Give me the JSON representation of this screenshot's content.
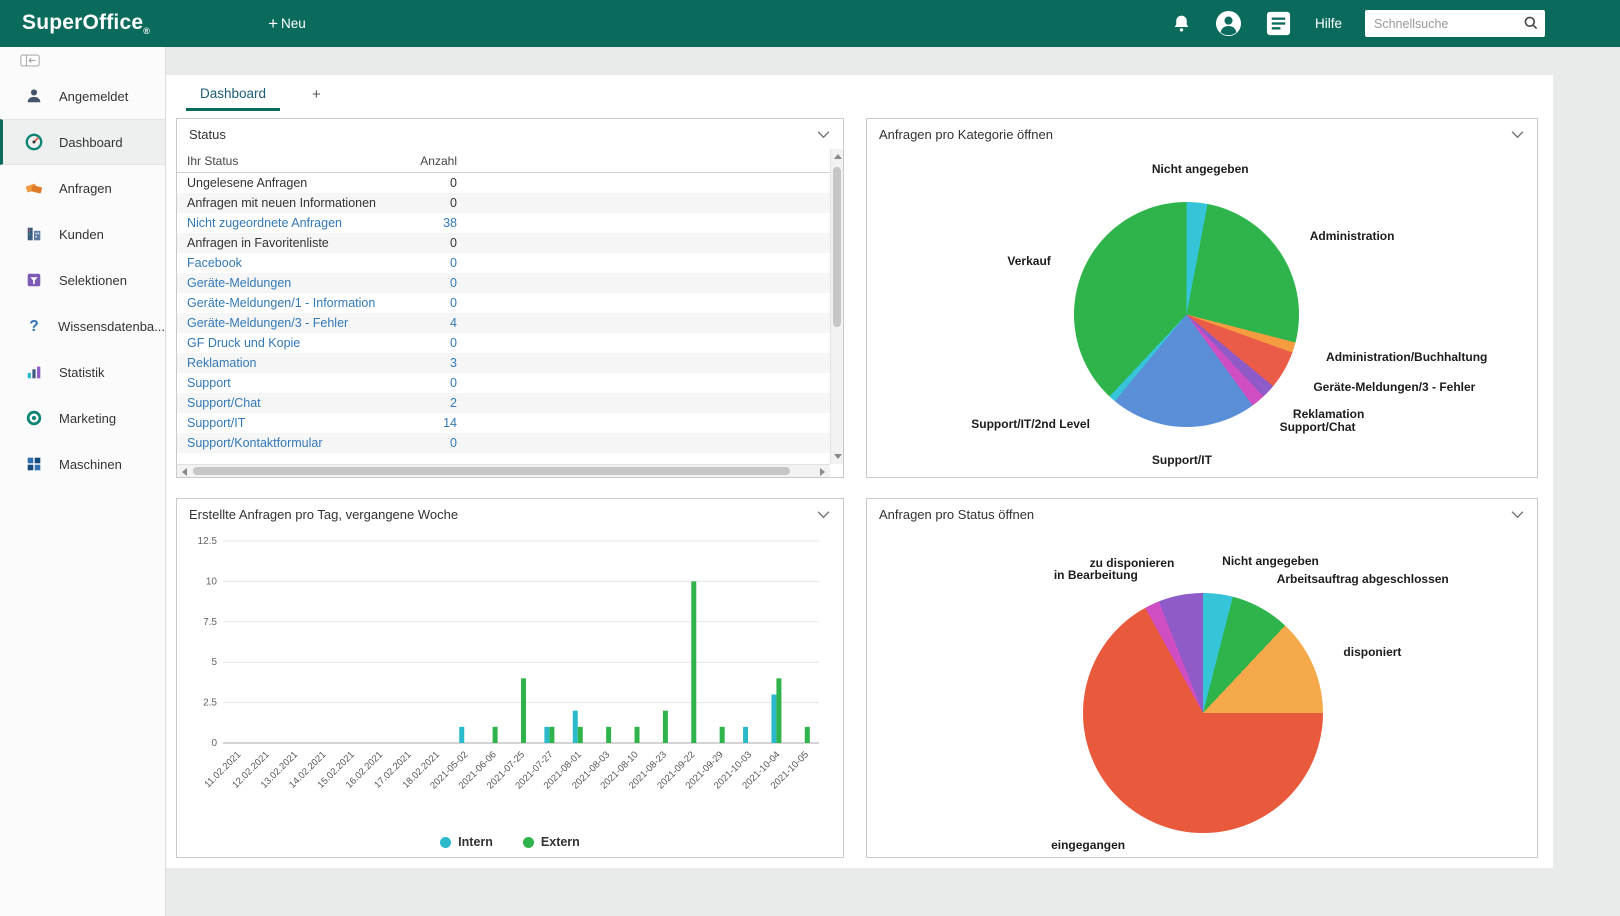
{
  "topbar": {
    "brand": "SuperOffice",
    "registered_mark": "®",
    "plus": "+",
    "new_label": "Neu",
    "help_label": "Hilfe",
    "search": {
      "placeholder": "Schnellsuche"
    }
  },
  "sidebar": {
    "items": [
      {
        "label": "Angemeldet",
        "icon": "person-icon",
        "active": false
      },
      {
        "label": "Dashboard",
        "icon": "dashboard-icon",
        "active": true
      },
      {
        "label": "Anfragen",
        "icon": "requests-icon",
        "active": false
      },
      {
        "label": "Kunden",
        "icon": "customers-icon",
        "active": false
      },
      {
        "label": "Selektionen",
        "icon": "selections-icon",
        "active": false
      },
      {
        "label": "Wissensdatenba...",
        "icon": "knowledgebase-icon",
        "active": false
      },
      {
        "label": "Statistik",
        "icon": "statistics-icon",
        "active": false
      },
      {
        "label": "Marketing",
        "icon": "marketing-icon",
        "active": false
      },
      {
        "label": "Maschinen",
        "icon": "machines-icon",
        "active": false
      }
    ]
  },
  "tabs": {
    "active_label": "Dashboard",
    "add_label": "+"
  },
  "panels": {
    "status": {
      "title": "Status",
      "columns": [
        "Ihr Status",
        "Anzahl"
      ],
      "rows": [
        {
          "label": "Ungelesene Anfragen",
          "value": "0",
          "link": false
        },
        {
          "label": "Anfragen mit neuen Informationen",
          "value": "0",
          "link": false
        },
        {
          "label": "Nicht zugeordnete Anfragen",
          "value": "38",
          "link": true
        },
        {
          "label": "Anfragen in Favoritenliste",
          "value": "0",
          "link": false
        },
        {
          "label": "Facebook",
          "value": "0",
          "link": true
        },
        {
          "label": "Geräte-Meldungen",
          "value": "0",
          "link": true
        },
        {
          "label": "Geräte-Meldungen/1 - Information",
          "value": "0",
          "link": true
        },
        {
          "label": "Geräte-Meldungen/3 - Fehler",
          "value": "4",
          "link": true
        },
        {
          "label": "GF Druck und Kopie",
          "value": "0",
          "link": true
        },
        {
          "label": "Reklamation",
          "value": "3",
          "link": true
        },
        {
          "label": "Support",
          "value": "0",
          "link": true
        },
        {
          "label": "Support/Chat",
          "value": "2",
          "link": true
        },
        {
          "label": "Support/IT",
          "value": "14",
          "link": true
        },
        {
          "label": "Support/Kontaktformular",
          "value": "0",
          "link": true
        }
      ]
    },
    "kategorie": {
      "title": "Anfragen pro Kategorie öffnen"
    },
    "bar": {
      "title": "Erstellte Anfragen pro Tag, vergangene Woche"
    },
    "status_pie": {
      "title": "Anfragen pro Status öffnen"
    }
  },
  "chart_data": [
    {
      "type": "pie",
      "title": "Anfragen pro Kategorie öffnen",
      "legend_position": "outside-labels",
      "slices": [
        {
          "label": "Nicht angegeben",
          "value": 3,
          "color": "#35c4d8"
        },
        {
          "label": "Administration",
          "value": 26,
          "color": "#2eb44b"
        },
        {
          "label": "Administration/Buchhaltung",
          "value": 1.5,
          "color": "#f59b40"
        },
        {
          "label": "Geräte-Meldungen/3 - Fehler",
          "value": 5.5,
          "color": "#ea5c48"
        },
        {
          "label": "Reklamation",
          "value": 2,
          "color": "#8e5bc8"
        },
        {
          "label": "Support/Chat",
          "value": 2,
          "color": "#cf4ec1"
        },
        {
          "label": "Support/IT",
          "value": 21,
          "color": "#5a8fd8"
        },
        {
          "label": "Support/IT/2nd Level",
          "value": 1,
          "color": "#35c4d8"
        },
        {
          "label": "Verkauf",
          "value": 38,
          "color": "#2eb44b"
        }
      ]
    },
    {
      "type": "bar",
      "title": "Erstellte Anfragen pro Tag, vergangene Woche",
      "categories": [
        "11.02.2021",
        "12.02.2021",
        "13.02.2021",
        "14.02.2021",
        "15.02.2021",
        "16.02.2021",
        "17.02.2021",
        "18.02.2021",
        "2021-05-02",
        "2021-06-06",
        "2021-07-25",
        "2021-07-27",
        "2021-08-01",
        "2021-08-03",
        "2021-08-10",
        "2021-08-23",
        "2021-09-22",
        "2021-09-29",
        "2021-10-03",
        "2021-10-04",
        "2021-10-05"
      ],
      "series": [
        {
          "name": "Intern",
          "color": "#2bb9cc",
          "values": [
            0,
            0,
            0,
            0,
            0,
            0,
            0,
            0,
            1,
            0,
            0,
            1,
            2,
            0,
            0,
            0,
            0,
            0,
            1,
            3,
            0
          ]
        },
        {
          "name": "Extern",
          "color": "#2eb44b",
          "values": [
            0,
            0,
            0,
            0,
            0,
            0,
            0,
            0,
            0,
            1,
            4,
            1,
            1,
            1,
            1,
            2,
            10,
            1,
            0,
            4,
            1
          ]
        }
      ],
      "ylim": [
        0,
        12.5
      ],
      "yticks": [
        0,
        2.5,
        5,
        7.5,
        10,
        12.5
      ],
      "grid": true,
      "legend_position": "bottom"
    },
    {
      "type": "pie",
      "title": "Anfragen pro Status öffnen",
      "legend_position": "outside-labels",
      "slices": [
        {
          "label": "Nicht angegeben",
          "value": 4,
          "color": "#35c4d8"
        },
        {
          "label": "Arbeitsauftrag abgeschlossen",
          "value": 8,
          "color": "#2eb44b"
        },
        {
          "label": "disponiert",
          "value": 13,
          "color": "#f5a94a"
        },
        {
          "label": "eingegangen",
          "value": 67,
          "color": "#e9593c"
        },
        {
          "label": "in Bearbeitung",
          "value": 2,
          "color": "#cf4ec1"
        },
        {
          "label": "zu disponieren",
          "value": 6,
          "color": "#8e5bc8"
        }
      ]
    }
  ]
}
